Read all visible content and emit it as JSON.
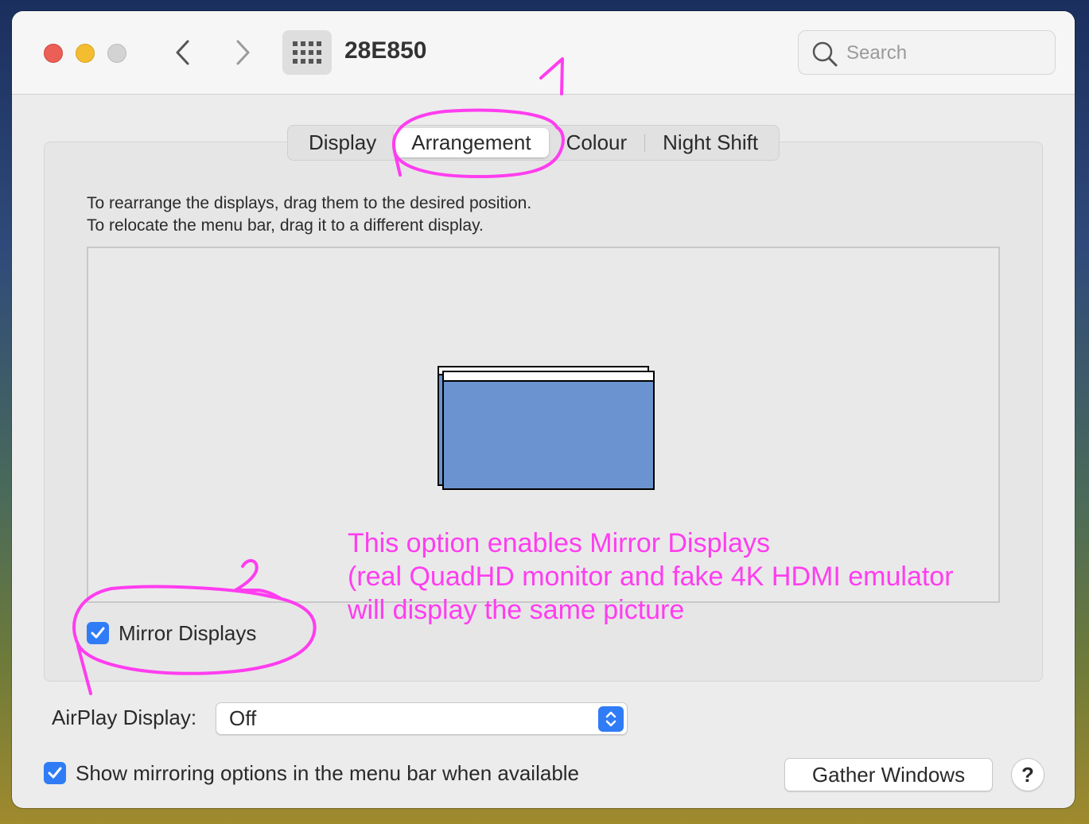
{
  "window": {
    "title": "28E850"
  },
  "search": {
    "placeholder": "Search"
  },
  "tabs": [
    {
      "label": "Display",
      "active": false
    },
    {
      "label": "Arrangement",
      "active": true
    },
    {
      "label": "Colour",
      "active": false
    },
    {
      "label": "Night Shift",
      "active": false
    }
  ],
  "arrangement": {
    "instruction_line1": "To rearrange the displays, drag them to the desired position.",
    "instruction_line2": "To relocate the menu bar, drag it to a different display.",
    "mirror_displays_label": "Mirror Displays",
    "mirror_displays_checked": true
  },
  "airplay": {
    "label": "AirPlay Display:",
    "value": "Off"
  },
  "footer": {
    "show_mirroring_label": "Show mirroring options in the menu bar when available",
    "show_mirroring_checked": true,
    "gather_windows_label": "Gather Windows",
    "help_label": "?"
  },
  "annotations": {
    "marker1": "1",
    "marker2": "2",
    "line1": "This option enables Mirror Displays",
    "line2": "(real QuadHD monitor and fake 4K HDMI emulator",
    "line3": "will display the same picture",
    "color": "#ff3df0"
  },
  "colors": {
    "accent": "#2f7cf6",
    "display_fill": "#6b93cf",
    "annotation": "#ff3df0"
  },
  "icons": {
    "back": "chevron-left-icon",
    "forward": "chevron-right-icon",
    "grid": "grid-icon",
    "search": "search-icon",
    "checkmark": "checkmark-icon",
    "stepper": "up-down-chevron-icon"
  }
}
